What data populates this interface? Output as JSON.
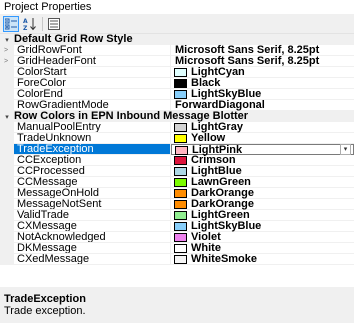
{
  "window": {
    "title": "Project Properties"
  },
  "toolbar": {
    "buttons": [
      {
        "name": "categorized-button",
        "icon": "categorized-icon",
        "active": true
      },
      {
        "name": "alphabetical-button",
        "icon": "sort-az-icon",
        "active": false
      },
      {
        "name": "property-pages-button",
        "icon": "property-pages-icon",
        "active": false
      }
    ]
  },
  "grid": {
    "categories": [
      {
        "label": "Default Grid Row Style",
        "rows": [
          {
            "name": "GridRowFont",
            "value": "Microsoft Sans Serif, 8.25pt",
            "expandable": true
          },
          {
            "name": "GridHeaderFont",
            "value": "Microsoft Sans Serif, 8.25pt",
            "expandable": true
          },
          {
            "name": "ColorStart",
            "value": "LightCyan",
            "color": "#e0ffff"
          },
          {
            "name": "ForeColor",
            "value": "Black",
            "color": "#000000"
          },
          {
            "name": "ColorEnd",
            "value": "LightSkyBlue",
            "color": "#87cefa"
          },
          {
            "name": "RowGradientMode",
            "value": "ForwardDiagonal"
          }
        ]
      },
      {
        "label": "Row Colors in EPN Inbound Message Blotter",
        "rows": [
          {
            "name": "ManualPoolEntry",
            "value": "LightGray",
            "color": "#d3d3d3"
          },
          {
            "name": "TradeUnknown",
            "value": "Yellow",
            "color": "#ffff00"
          },
          {
            "name": "TradeException",
            "value": "LightPink",
            "color": "#ffb6c1",
            "selected": true
          },
          {
            "name": "CCException",
            "value": "Crimson",
            "color": "#dc143c"
          },
          {
            "name": "CCProcessed",
            "value": "LightBlue",
            "color": "#add8e6"
          },
          {
            "name": "CCMessage",
            "value": "LawnGreen",
            "color": "#7cfc00"
          },
          {
            "name": "MessageOnHold",
            "value": "DarkOrange",
            "color": "#ff8c00"
          },
          {
            "name": "MessageNotSent",
            "value": "DarkOrange",
            "color": "#ff8c00"
          },
          {
            "name": "ValidTrade",
            "value": "LightGreen",
            "color": "#90ee90"
          },
          {
            "name": "CXMessage",
            "value": "LightSkyBlue",
            "color": "#87cefa"
          },
          {
            "name": "NotAcknowledged",
            "value": "Violet",
            "color": "#ee82ee"
          },
          {
            "name": "DKMessage",
            "value": "White",
            "color": "#ffffff"
          },
          {
            "name": "CXedMessage",
            "value": "WhiteSmoke",
            "color": "#f5f5f5"
          }
        ]
      }
    ],
    "selection_color": "#0078d7"
  },
  "description": {
    "title": "TradeException",
    "text": "Trade exception."
  }
}
